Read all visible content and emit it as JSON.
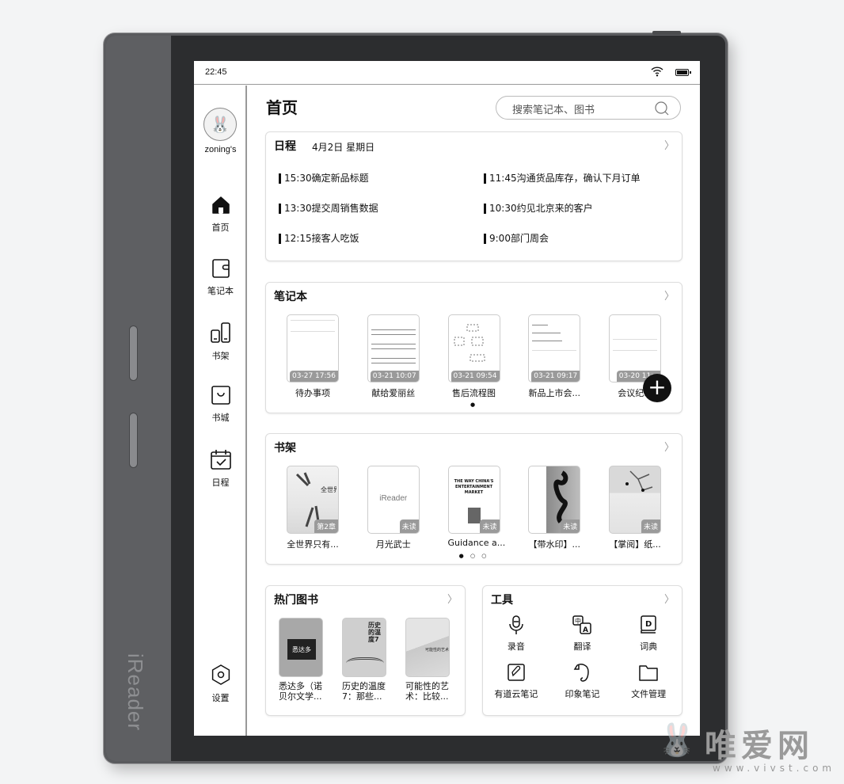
{
  "device": {
    "brand": "iReader"
  },
  "statusbar": {
    "time": "22:45",
    "wifi_icon": "wifi-icon",
    "battery_icon": "battery-icon"
  },
  "sidebar": {
    "user": {
      "name": "zoning's"
    },
    "items": [
      {
        "label": "首页",
        "icon": "home-icon",
        "active": true
      },
      {
        "label": "笔记本",
        "icon": "notebook-icon"
      },
      {
        "label": "书架",
        "icon": "bookshelf-icon"
      },
      {
        "label": "书城",
        "icon": "bookstore-icon"
      },
      {
        "label": "日程",
        "icon": "calendar-icon"
      }
    ],
    "settings": {
      "label": "设置",
      "icon": "settings-icon"
    }
  },
  "header": {
    "title": "首页",
    "search_placeholder": "搜索笔记本、图书"
  },
  "schedule": {
    "title": "日程",
    "date": "4月2日 星期日",
    "items": [
      "15:30确定新品标题",
      "11:45沟通货品库存，确认下月订单",
      "13:30提交周销售数据",
      "10:30约见北京来的客户",
      "12:15接客人吃饭",
      "9:00部门周会"
    ]
  },
  "notebooks": {
    "title": "笔记本",
    "items": [
      {
        "name": "待办事项",
        "time": "03-27 17:56"
      },
      {
        "name": "献给爱丽丝",
        "time": "03-21 10:07"
      },
      {
        "name": "售后流程图",
        "time": "03-21 09:54"
      },
      {
        "name": "新品上市会...",
        "time": "03-21 09:17"
      },
      {
        "name": "会议纪...",
        "time": "03-20 11:.."
      }
    ],
    "page_dots": "●",
    "add_label": "+"
  },
  "bookshelf": {
    "title": "书架",
    "items": [
      {
        "name": "全世界只有...",
        "badge": "第2章"
      },
      {
        "name": "月光武士",
        "badge": "未读",
        "cover_text": "iReader"
      },
      {
        "name": "Guidance a...",
        "badge": "未读",
        "cover_text": "THE WAY CHINA'S ENTERTAINMENT MARKET"
      },
      {
        "name": "【带水印】...",
        "badge": "未读"
      },
      {
        "name": "【掌阅】纸...",
        "badge": "未读"
      }
    ],
    "page_dots": "● ○ ○"
  },
  "hot_books": {
    "title": "热门图书",
    "items": [
      {
        "name": "悉达多（诺贝尔文学...",
        "cover_text": "悉达多"
      },
      {
        "name": "历史的温度7：那些...",
        "cover_text": "历史的温度7"
      },
      {
        "name": "可能性的艺术：比较...",
        "cover_text": "可能性的艺术"
      }
    ]
  },
  "tools": {
    "title": "工具",
    "items": [
      {
        "label": "录音",
        "icon": "microphone-icon"
      },
      {
        "label": "翻译",
        "icon": "translate-icon"
      },
      {
        "label": "词典",
        "icon": "dictionary-icon"
      },
      {
        "label": "有道云笔记",
        "icon": "youdao-note-icon"
      },
      {
        "label": "印象笔记",
        "icon": "evernote-icon"
      },
      {
        "label": "文件管理",
        "icon": "folder-icon"
      }
    ]
  },
  "watermark": {
    "text": "唯爱网",
    "url": "www.vivst.com"
  },
  "colors": {
    "bezel": "#2c2d2f",
    "grip": "#5e5f62",
    "ink": "#111111",
    "badge": "#9a9a9a"
  }
}
